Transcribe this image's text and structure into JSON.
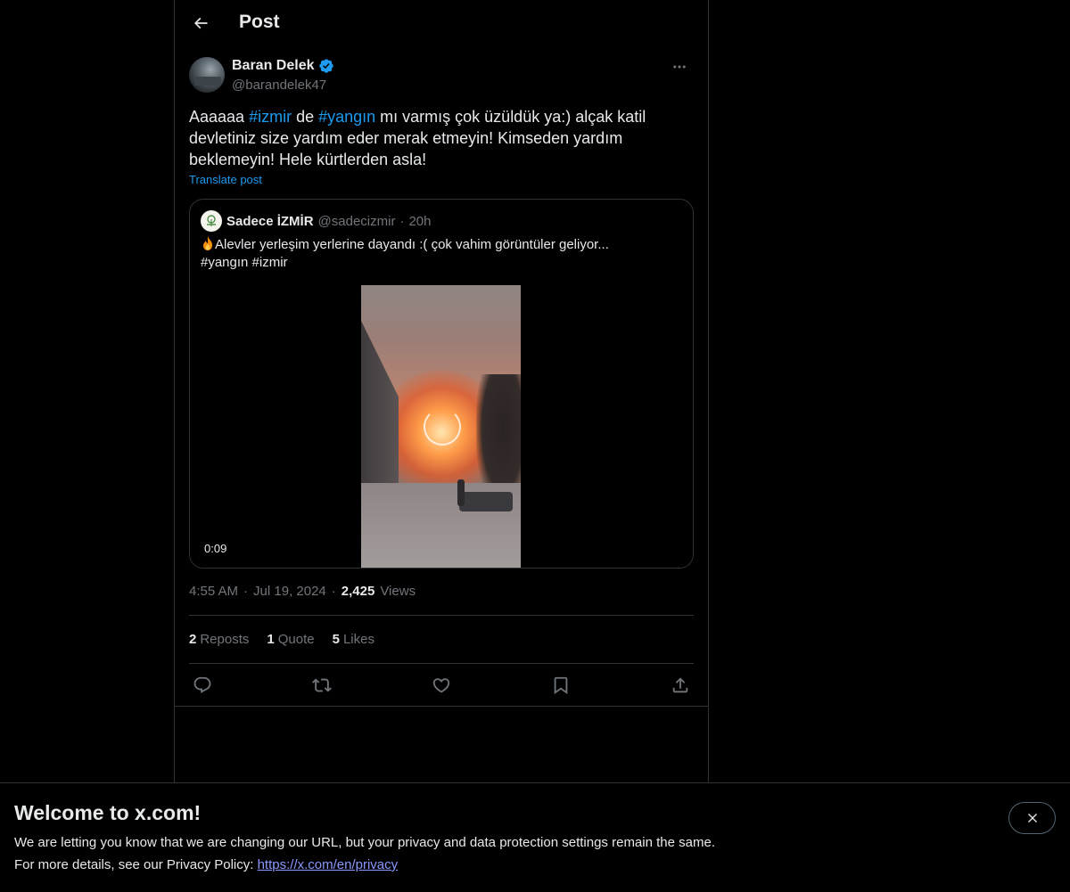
{
  "header": {
    "title": "Post"
  },
  "author": {
    "name": "Baran Delek",
    "handle": "@barandelek47",
    "verified": true
  },
  "post": {
    "text_parts": [
      "Aaaaaa ",
      "#izmir",
      " de ",
      "#yangın",
      " mı varmış çok üzüldük ya:) alçak katil devletiniz size yardım eder merak etmeyin! Kimseden yardım beklemeyin! Hele kürtlerden asla!"
    ],
    "translate_label": "Translate post",
    "time": "4:55 AM",
    "date": "Jul 19, 2024",
    "views_count": "2,425",
    "views_label": "Views"
  },
  "quote": {
    "name": "Sadece İZMİR",
    "handle": "@sadecizmir",
    "time": "20h",
    "text": "Alevler yerleşim yerlerine dayandı :( çok vahim görüntüler geliyor...",
    "hashtags": "#yangın #izmir",
    "video_duration": "0:09"
  },
  "stats": {
    "reposts_count": "2",
    "reposts_label": "Reposts",
    "quotes_count": "1",
    "quotes_label": "Quote",
    "likes_count": "5",
    "likes_label": "Likes"
  },
  "actions": [
    "reply-icon",
    "repost-icon",
    "like-icon",
    "bookmark-icon",
    "share-icon"
  ],
  "banner": {
    "title": "Welcome to x.com!",
    "line1": "We are letting you know that we are changing our URL, but your privacy and data protection settings remain the same.",
    "line2_prefix": "For more details, see our Privacy Policy: ",
    "link": "https://x.com/en/privacy"
  },
  "colors": {
    "background": "#000000",
    "text": "#e7e9ea",
    "secondary": "#71767b",
    "accent": "#1d9bf0",
    "link": "#8b98ff",
    "border": "#2f3336"
  }
}
